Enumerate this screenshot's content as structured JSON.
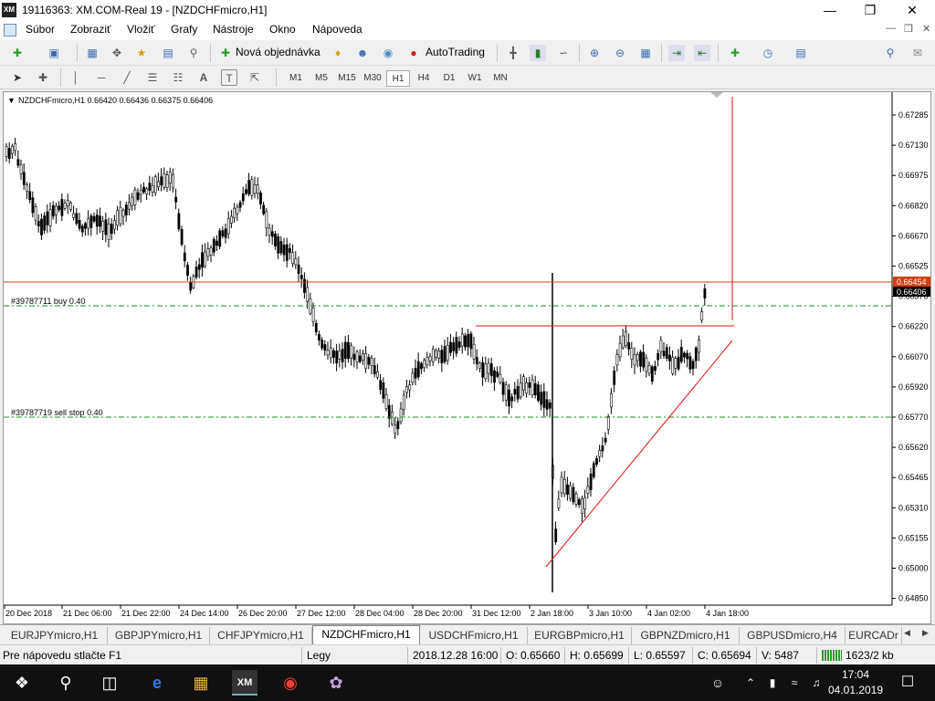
{
  "window": {
    "title": "19116363: XM.COM-Real 19 - [NZDCHFmicro,H1]",
    "app_logo": "XM"
  },
  "menu": [
    "Súbor",
    "Zobraziť",
    "Vložiť",
    "Grafy",
    "Nástroje",
    "Okno",
    "Nápoveda"
  ],
  "toolbar": {
    "new_order": "Nová objednávka",
    "autotrading": "AutoTrading"
  },
  "timeframes": [
    "M1",
    "M5",
    "M15",
    "M30",
    "H1",
    "H4",
    "D1",
    "W1",
    "MN"
  ],
  "active_timeframe": "H1",
  "chart": {
    "header": "NZDCHFmicro,H1  0.66420 0.66436 0.66375 0.66406",
    "buy_label": "#39787711 buy 0.40",
    "sell_stop_label": "#39787719 sell stop 0.40",
    "price_ticks": [
      "0.67285",
      "0.67130",
      "0.66975",
      "0.66820",
      "0.66670",
      "0.66525",
      "0.66370",
      "0.66220",
      "0.66070",
      "0.65920",
      "0.65770",
      "0.65620",
      "0.65465",
      "0.65310",
      "0.65155",
      "0.65000",
      "0.64850"
    ],
    "current_ask": "0.66454",
    "current_bid": "0.66406",
    "time_ticks": [
      "20 Dec 2018",
      "21 Dec 06:00",
      "21 Dec 22:00",
      "24 Dec 14:00",
      "26 Dec 20:00",
      "27 Dec 12:00",
      "28 Dec 04:00",
      "28 Dec 20:00",
      "31 Dec 12:00",
      "2 Jan 18:00",
      "3 Jan 10:00",
      "4 Jan 02:00",
      "4 Jan 18:00"
    ],
    "colors": {
      "bid_line": "#d04010",
      "trade_line": "#228b22",
      "trendline": "#e01010",
      "candle": "#000000"
    }
  },
  "tabs": [
    "EURJPYmicro,H1",
    "GBPJPYmicro,H1",
    "CHFJPYmicro,H1",
    "NZDCHFmicro,H1",
    "USDCHFmicro,H1",
    "EURGBPmicro,H1",
    "GBPNZDmicro,H1",
    "GBPUSDmicro,H4",
    "EURCADr"
  ],
  "active_tab": "NZDCHFmicro,H1",
  "status": {
    "help": "Pre nápovedu stlačte F1",
    "profile": "Legy",
    "datetime": "2018.12.28 16:00",
    "open": "O: 0.65660",
    "high": "H: 0.65699",
    "low": "L: 0.65597",
    "close": "C: 0.65694",
    "volume": "V: 5487",
    "traffic": "1623/2 kb"
  },
  "taskbar": {
    "time": "17:04",
    "date": "04.01.2019"
  }
}
